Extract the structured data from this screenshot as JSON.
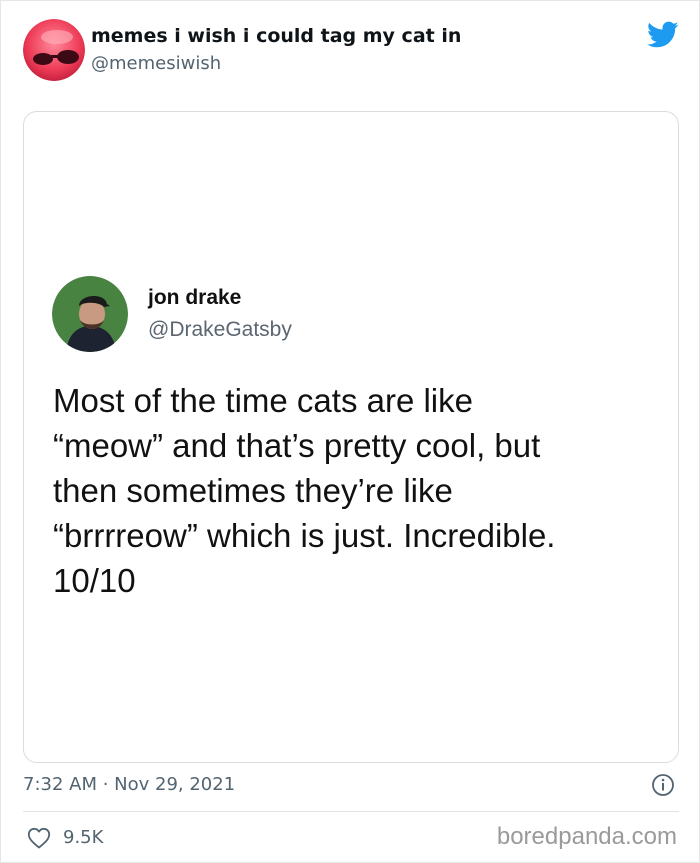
{
  "tweet": {
    "author": {
      "name": "memes i wish i could tag my cat in",
      "handle": "@memesiwish"
    },
    "embedded_post": {
      "name": "jon drake",
      "handle": "@DrakeGatsby",
      "text_lines": [
        "Most of the time cats are like",
        "“meow” and that’s pretty cool, but",
        "then sometimes they’re like",
        "“brrrreow” which is just. Incredible.",
        "10/10"
      ]
    },
    "timestamp": "7:32 AM · Nov 29, 2021",
    "like_count": "9.5K",
    "watermark": "boredpanda.com"
  },
  "icons": {
    "brand": "twitter-bird-icon",
    "info": "info-icon",
    "like": "heart-icon"
  },
  "colors": {
    "twitter_blue": "#1d9bf0",
    "secondary_text": "#536471",
    "avatar_pink": "#ee3b57"
  }
}
